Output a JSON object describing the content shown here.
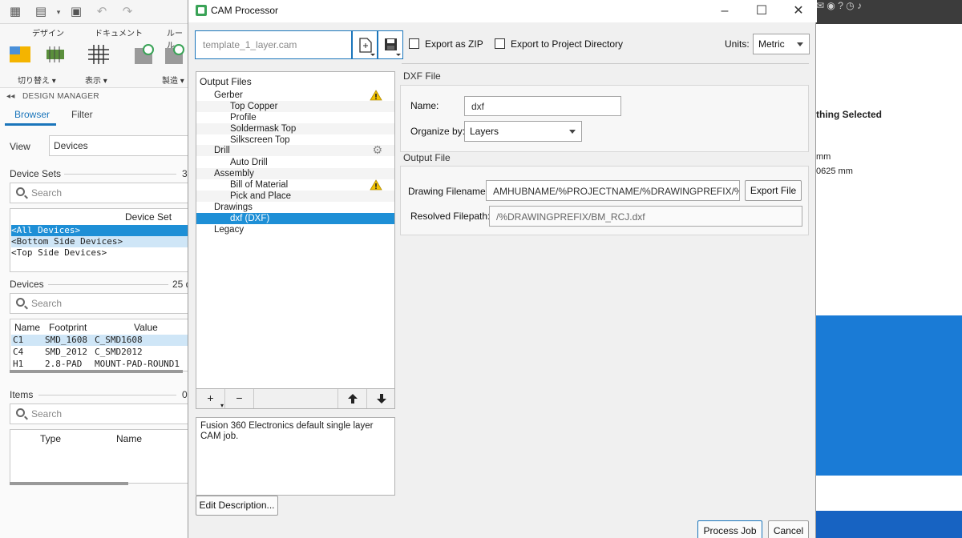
{
  "background_app": {
    "ribbon_tabs": [
      "デザイン",
      "ドキュメント",
      "ルール"
    ],
    "ribbon_captions": [
      "切り替え ▾",
      "表示 ▾",
      "製造 ▾"
    ],
    "panel_title": "DESIGN MANAGER",
    "tabs": [
      "Browser",
      "Filter"
    ],
    "view_label": "View",
    "view_value": "Devices",
    "device_sets_label": "Device Sets",
    "device_sets_count": "3",
    "search_placeholder": "Search",
    "device_set_header": "Device Set",
    "device_sets": [
      "<All Devices>",
      "<Bottom Side Devices>",
      "<Top Side Devices>"
    ],
    "devices_label": "Devices",
    "devices_count": "25 d",
    "devices_columns": [
      "Name",
      "Footprint",
      "Value"
    ],
    "devices_rows": [
      [
        "C1",
        "SMD_1608",
        "C_SMD1608"
      ],
      [
        "C4",
        "SMD_2012",
        "C_SMD2012"
      ],
      [
        "H1",
        "2.8-PAD",
        "MOUNT-PAD-ROUND1"
      ]
    ],
    "items_label": "Items",
    "items_count": "0",
    "items_columns": [
      "Type",
      "Name"
    ],
    "right_panel_title": "thing Selected",
    "right_panel_lines": [
      "mm",
      "0625 mm"
    ]
  },
  "dialog": {
    "title": "CAM Processor",
    "job_name": "template_1_layer.cam",
    "export_zip_label": "Export as ZIP",
    "export_zip_checked": false,
    "export_project_label": "Export to Project Directory",
    "export_project_checked": false,
    "units_label": "Units:",
    "units_value": "Metric",
    "tree_root": "Output Files",
    "tree": [
      {
        "label": "Gerber",
        "level": 1,
        "icon": "warning-icon"
      },
      {
        "label": "Top Copper",
        "level": 2
      },
      {
        "label": "Profile",
        "level": 2
      },
      {
        "label": "Soldermask Top",
        "level": 2
      },
      {
        "label": "Silkscreen Top",
        "level": 2
      },
      {
        "label": "Drill",
        "level": 1,
        "icon": "gear-icon"
      },
      {
        "label": "Auto Drill",
        "level": 2
      },
      {
        "label": "Assembly",
        "level": 1
      },
      {
        "label": "Bill of Material",
        "level": 2,
        "icon": "warning-icon"
      },
      {
        "label": "Pick and Place",
        "level": 2
      },
      {
        "label": "Drawings",
        "level": 1
      },
      {
        "label": "dxf (DXF)",
        "level": 2,
        "selected": true
      },
      {
        "label": "Legacy",
        "level": 1
      }
    ],
    "tree_tools": {
      "add": "+",
      "remove": "−",
      "up": "🡅",
      "down": "🡇"
    },
    "description": "Fusion 360 Electronics default single layer CAM job.",
    "edit_description_label": "Edit Description...",
    "dxf_section_title": "DXF File",
    "name_label": "Name:",
    "name_value": "dxf",
    "organize_label": "Organize by:",
    "organize_value": "Layers",
    "output_section_title": "Output File",
    "drawing_filename_label": "Drawing Filename:",
    "drawing_filename_value": "AMHUBNAME/%PROJECTNAME/%DRAWINGPREFIX/%N.dxf",
    "export_file_label": "Export File",
    "resolved_filepath_label": "Resolved Filepath:",
    "resolved_filepath_value": "/%DRAWINGPREFIX/BM_RCJ.dxf",
    "process_job_label": "Process Job",
    "cancel_label": "Cancel",
    "accent_color": "#1e8fd6",
    "warning_color": "#f2c200"
  }
}
